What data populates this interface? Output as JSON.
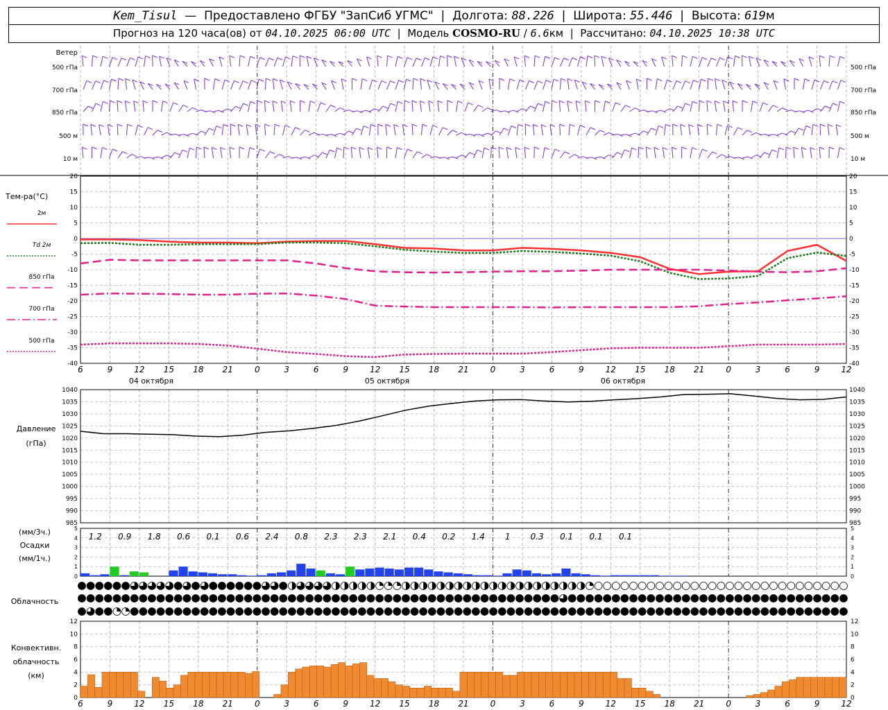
{
  "header": {
    "station": "Kem_Tisul",
    "provider": "Предоставлено ФГБУ \"ЗапСиб УГМС\"",
    "lon_label": "Долгота:",
    "lon_value": "88.226",
    "lat_label": "Широта:",
    "lat_value": "55.446",
    "alt_label": "Высота:",
    "alt_value": "619",
    "alt_unit": "м",
    "forecast_text": "Прогноз на 120 часа(ов) от",
    "forecast_start": "04.10.2025 06:00 UTC",
    "model_label": "Модель",
    "model_name": "COSMO-RU",
    "model_res": "6.6",
    "model_res_unit": "км",
    "calc_label": "Рассчитано:",
    "calc_time": "04.10.2025 10:38 UTC"
  },
  "time_axis": {
    "ticks": [
      "6",
      "9",
      "12",
      "15",
      "18",
      "21",
      "0",
      "3",
      "6",
      "9",
      "12",
      "15",
      "18",
      "21",
      "0",
      "3",
      "6",
      "9",
      "12",
      "15",
      "18",
      "21",
      "0",
      "3",
      "6",
      "9",
      "12"
    ],
    "dates": [
      "04 октября",
      "05 октября",
      "06 октября"
    ]
  },
  "wind": {
    "title": "Ветер",
    "levels": [
      "500 гПа",
      "700 гПа",
      "850 гПа",
      "500 м",
      "10 м"
    ],
    "color": "#7b2fd6"
  },
  "temperature": {
    "title": "Тем-ра(°C)",
    "legend": [
      {
        "label": "2м",
        "color": "#ff3030",
        "style": "solid"
      },
      {
        "label": "Td  2м",
        "color": "#1a7a1a",
        "style": "dotted"
      },
      {
        "label": "850 гПа",
        "color": "#e0208a",
        "style": "dashed"
      },
      {
        "label": "700 гПа",
        "color": "#e0208a",
        "style": "dashdot"
      },
      {
        "label": "500 гПа",
        "color": "#e0208a",
        "style": "dotted"
      }
    ],
    "yticks": [
      "20",
      "15",
      "10",
      "5",
      "0",
      "-5",
      "-10",
      "-15",
      "-20",
      "-25",
      "-30",
      "-35",
      "-40"
    ]
  },
  "pressure": {
    "title": "Давление",
    "unit": "(гПа)",
    "yticks": [
      "1040",
      "1035",
      "1030",
      "1025",
      "1020",
      "1015",
      "1010",
      "1005",
      "1000",
      "995",
      "990",
      "985"
    ]
  },
  "precip": {
    "unit_top": "(мм/3ч.)",
    "title": "Осадки",
    "unit_bottom": "(мм/1ч.)",
    "yticks": [
      "5",
      "4",
      "3",
      "2",
      "1",
      "0"
    ],
    "totals": [
      "1.2",
      "0.9",
      "1.8",
      "0.6",
      "0.1",
      "0.6",
      "2.4",
      "0.8",
      "2.3",
      "2.3",
      "2.1",
      "0.4",
      "0.2",
      "1.4",
      "1",
      "0.3",
      "0.1",
      "0.1",
      "0.1"
    ]
  },
  "cloud": {
    "title": "Облачность"
  },
  "convective": {
    "title_1": "Конвективн.",
    "title_2": "облачность",
    "unit": "(км)",
    "yticks": [
      "12",
      "10",
      "8",
      "6",
      "4",
      "2",
      "0"
    ],
    "color": "#f08a30"
  },
  "chart_data": [
    {
      "type": "line",
      "title": "Тем-ра(°C)",
      "x_hours": [
        0,
        3,
        6,
        9,
        12,
        15,
        18,
        21,
        24,
        27,
        30,
        33,
        36,
        39,
        42,
        45,
        48,
        51,
        54,
        57,
        60,
        63,
        66,
        69,
        72,
        75,
        78
      ],
      "ylim": [
        -40,
        20
      ],
      "series": [
        {
          "name": "2м",
          "values": [
            -0.3,
            -0.3,
            -0.5,
            -1.0,
            -1.3,
            -1.3,
            -1.5,
            -1.0,
            -0.8,
            -0.8,
            -1.8,
            -3.0,
            -3.2,
            -3.8,
            -3.8,
            -3.0,
            -3.3,
            -3.8,
            -4.6,
            -6.0,
            -9.7,
            -11.4,
            -10.6,
            -10.5,
            -4.0,
            -2.0,
            -7.2
          ]
        },
        {
          "name": "Td  2м",
          "values": [
            -1.5,
            -1.4,
            -2.0,
            -2.0,
            -1.8,
            -1.8,
            -1.8,
            -1.3,
            -1.3,
            -1.5,
            -2.5,
            -3.6,
            -4.2,
            -4.6,
            -4.6,
            -4.0,
            -4.3,
            -4.8,
            -5.5,
            -7.3,
            -11.0,
            -13.0,
            -12.8,
            -12.0,
            -6.3,
            -4.5,
            -5.6
          ]
        },
        {
          "name": "850 гПа",
          "values": [
            -8.0,
            -6.8,
            -7.0,
            -7.0,
            -7.0,
            -7.0,
            -7.0,
            -7.0,
            -8.0,
            -9.5,
            -10.5,
            -10.8,
            -10.9,
            -10.8,
            -10.6,
            -10.5,
            -10.5,
            -10.3,
            -10.0,
            -10.0,
            -10.0,
            -10.0,
            -10.3,
            -10.6,
            -10.8,
            -10.5,
            -9.5
          ]
        },
        {
          "name": "700 гПа",
          "values": [
            -18.0,
            -17.6,
            -17.7,
            -17.8,
            -18.0,
            -18.0,
            -17.7,
            -17.6,
            -18.3,
            -19.4,
            -21.5,
            -21.8,
            -22.0,
            -22.0,
            -22.0,
            -22.0,
            -22.1,
            -22.0,
            -22.0,
            -22.0,
            -22.0,
            -21.7,
            -21.0,
            -20.5,
            -19.8,
            -19.2,
            -18.5
          ]
        },
        {
          "name": "500 гПа",
          "values": [
            -34.0,
            -33.6,
            -33.6,
            -33.6,
            -33.8,
            -34.3,
            -35.3,
            -36.4,
            -37.0,
            -37.7,
            -38.0,
            -37.2,
            -37.0,
            -36.9,
            -36.9,
            -36.9,
            -36.4,
            -35.8,
            -35.2,
            -35.0,
            -35.0,
            -35.0,
            -34.5,
            -34.0,
            -34.0,
            -34.0,
            -33.8
          ]
        }
      ]
    },
    {
      "type": "line",
      "title": "Давление",
      "x_hours": [
        0,
        3,
        6,
        9,
        12,
        15,
        18,
        21,
        24,
        27,
        30,
        33,
        36,
        39,
        42,
        45,
        48,
        51,
        54,
        57,
        60,
        63,
        66,
        69,
        72,
        75,
        78
      ],
      "ylim": [
        985,
        1040
      ],
      "series": [
        {
          "name": "",
          "values": [
            1022.8,
            1021.8,
            1021.8,
            1021.6,
            1021.4,
            1020.8,
            1020.6,
            1021.2,
            1022.4,
            1023.0,
            1024.0,
            1025.2,
            1027.0,
            1029.2,
            1031.5,
            1033.2,
            1034.3,
            1035.3,
            1035.8,
            1035.9,
            1035.3,
            1034.9,
            1035.2,
            1035.8,
            1036.3,
            1037.0,
            1038.0,
            1038.1,
            1038.3,
            1037.4,
            1036.4,
            1035.8,
            1036.0,
            1037.0
          ]
        }
      ],
      "note_hours": [
        0,
        3,
        6,
        9,
        12,
        15,
        18,
        21,
        24,
        27,
        30,
        33,
        36,
        39,
        42,
        45,
        48,
        51,
        54,
        57,
        60,
        63,
        66,
        69,
        72,
        75,
        78,
        81,
        84,
        87,
        90,
        93,
        96,
        99
      ]
    },
    {
      "type": "bar",
      "title": "Осадки",
      "ylim": [
        0,
        5
      ],
      "rain_mm_per_h": [
        0.3,
        0.1,
        0.2,
        1.0,
        0.1,
        0.5,
        0.4,
        0.0,
        0.0,
        0.6,
        1.0,
        0.5,
        0.4,
        0.3,
        0.2,
        0.2,
        0.1,
        0.05,
        0.1,
        0.3,
        0.4,
        0.6,
        1.3,
        0.8,
        0.6,
        0.3,
        0.2,
        1.0,
        0.7,
        0.8,
        0.9,
        0.8,
        0.7,
        0.9,
        0.9,
        0.7,
        0.5,
        0.4,
        0.3,
        0.2,
        0.1,
        0.1,
        0.05,
        0.3,
        0.7,
        0.6,
        0.3,
        0.2,
        0.3,
        0.8,
        0.3,
        0.2,
        0.1,
        0.05,
        0.1,
        0.1,
        0.1,
        0.1,
        0.1,
        0.05,
        0.05,
        0.05
      ],
      "snow_mm_per_h": [
        0,
        0,
        0,
        1.0,
        0,
        0.5,
        0.4,
        0,
        0,
        0,
        0,
        0,
        0,
        0,
        0,
        0,
        0,
        0,
        0,
        0,
        0,
        0,
        0,
        0,
        0.6,
        0,
        0,
        1.0,
        0,
        0,
        0,
        0,
        0,
        0,
        0,
        0,
        0,
        0,
        0,
        0,
        0,
        0,
        0,
        0,
        0,
        0,
        0,
        0,
        0,
        0,
        0,
        0,
        0,
        0,
        0,
        0,
        0,
        0,
        0,
        0,
        0,
        0
      ]
    },
    {
      "type": "bar",
      "title": "Конвективн. облачность",
      "ylim": [
        0,
        12
      ],
      "values_km": [
        1.8,
        3.6,
        1.6,
        4.0,
        4.0,
        4.0,
        4.0,
        4.0,
        1.0,
        0,
        3.2,
        2.6,
        1.5,
        2.0,
        3.5,
        4.0,
        4.0,
        4.0,
        4.0,
        4.0,
        4.0,
        4.0,
        4.0,
        3.8,
        4.1,
        0,
        0,
        0.5,
        2.0,
        4.0,
        4.5,
        4.8,
        5.0,
        5.0,
        4.8,
        5.2,
        5.5,
        5.0,
        5.3,
        5.5,
        3.5,
        3.0,
        3.0,
        2.5,
        2.0,
        1.8,
        1.5,
        1.5,
        1.8,
        1.5,
        1.5,
        1.5,
        1.0,
        4.0,
        4.0,
        4.0,
        4.0,
        4.0,
        4.0,
        3.5,
        3.5,
        4.0,
        4.0,
        4.0,
        4.0,
        4.0,
        4.0,
        4.0,
        4.0,
        4.0,
        4.0,
        4.0,
        4.0,
        4.0,
        4.0,
        3.0,
        3.0,
        1.5,
        1.5,
        1.0,
        0.5,
        0,
        0,
        0,
        0,
        0,
        0,
        0,
        0,
        0,
        0,
        0,
        0,
        0.3,
        0.5,
        0.8,
        1.2,
        1.8,
        2.5,
        2.8,
        3.2,
        3.2,
        3.2,
        3.2,
        3.2,
        3.2,
        3.2
      ],
      "bar_hours_start": 0
    }
  ]
}
